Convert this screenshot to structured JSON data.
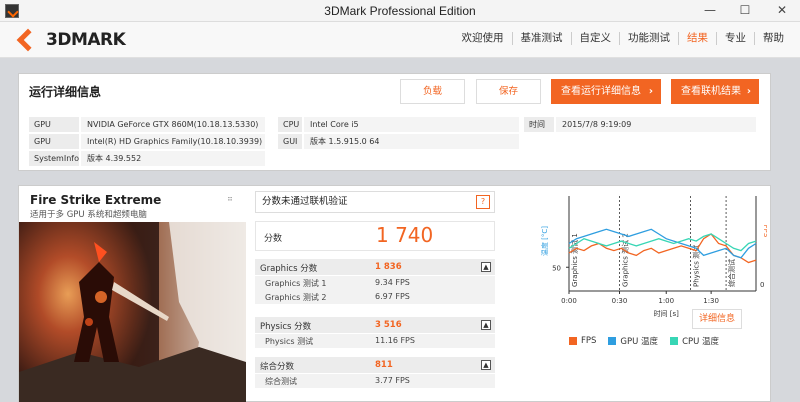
{
  "window": {
    "title": "3DMark Professional Edition",
    "minimize": "—",
    "maximize": "☐",
    "close": "✕"
  },
  "header": {
    "logo_text": "3DMARK",
    "nav": [
      "欢迎使用",
      "基准测试",
      "自定义",
      "功能测试",
      "结果",
      "专业",
      "帮助"
    ],
    "active": "结果"
  },
  "run": {
    "title": "运行详细信息",
    "load_label": "负载",
    "save_label": "保存",
    "details_label": "查看运行详细信息",
    "online_label": "查看联机结果",
    "rows": [
      {
        "k": "GPU",
        "v": "NVIDIA GeForce GTX 860M(10.18.13.5330)"
      },
      {
        "k": "GPU",
        "v": "Intel(R) HD Graphics Family(10.18.10.3939)"
      },
      {
        "k": "SystemInfo",
        "v": "版本 4.39.552"
      }
    ],
    "cpu": {
      "k": "CPU",
      "v": "Intel Core i5"
    },
    "gui": {
      "k": "GUI",
      "v": "版本 1.5.915.0 64"
    },
    "time": {
      "k": "时间",
      "v": "2015/7/8 9:19:09"
    }
  },
  "benchmark": {
    "title": "Fire Strike Extreme",
    "subtitle": "适用于多 GPU 系统和超频电脑",
    "warning": "分数未通过联机验证",
    "warning_icon": "?",
    "score_label": "分数",
    "score": "1 740",
    "graphics": {
      "label": "Graphics 分数",
      "value": "1 836",
      "tests": [
        {
          "k": "Graphics 测试 1",
          "v": "9.34 FPS"
        },
        {
          "k": "Graphics 测试 2",
          "v": "6.97 FPS"
        }
      ]
    },
    "physics": {
      "label": "Physics 分数",
      "value": "3 516",
      "tests": [
        {
          "k": "Physics 测试",
          "v": "11.16 FPS"
        }
      ]
    },
    "combined": {
      "label": "综合分数",
      "value": "811",
      "tests": [
        {
          "k": "综合测试",
          "v": "3.77 FPS"
        }
      ]
    },
    "toggle": "▲"
  },
  "chart_data": {
    "type": "line",
    "ylabel_left": "温度 [°C]",
    "ylabel_right": "FPS",
    "xlabel": "时间 [s]",
    "y_left_ticks": [
      "50"
    ],
    "y_right_ticks": [
      "0"
    ],
    "x_ticks": [
      "0:00",
      "0:30",
      "1:00",
      "1:30"
    ],
    "section_labels": [
      "Graphics 测试 1",
      "Graphics 测试 2",
      "Physics 测试",
      "综合测试"
    ],
    "detail_label": "详细信息",
    "legend": [
      {
        "name": "FPS",
        "color": "#f26522"
      },
      {
        "name": "GPU 温度",
        "color": "#2f9ee0"
      },
      {
        "name": "CPU 温度",
        "color": "#38d6b5"
      }
    ],
    "series": [
      {
        "name": "FPS",
        "values": [
          56,
          58,
          57,
          59,
          60,
          58,
          57,
          58,
          56,
          55,
          57,
          58,
          56,
          57,
          58,
          59,
          58,
          57,
          62,
          64,
          60,
          59,
          55,
          54,
          52,
          53
        ]
      },
      {
        "name": "GPU 温度",
        "values": [
          60,
          62,
          63,
          64,
          65,
          66,
          65,
          64,
          63,
          64,
          65,
          66,
          64,
          62,
          61,
          60,
          59,
          58,
          55,
          56,
          57,
          58,
          55,
          54,
          58,
          60
        ]
      },
      {
        "name": "CPU 温度",
        "values": [
          58,
          60,
          62,
          61,
          60,
          59,
          60,
          61,
          60,
          59,
          60,
          61,
          62,
          61,
          60,
          61,
          62,
          61,
          63,
          64,
          62,
          60,
          58,
          57,
          60,
          61
        ]
      }
    ]
  }
}
